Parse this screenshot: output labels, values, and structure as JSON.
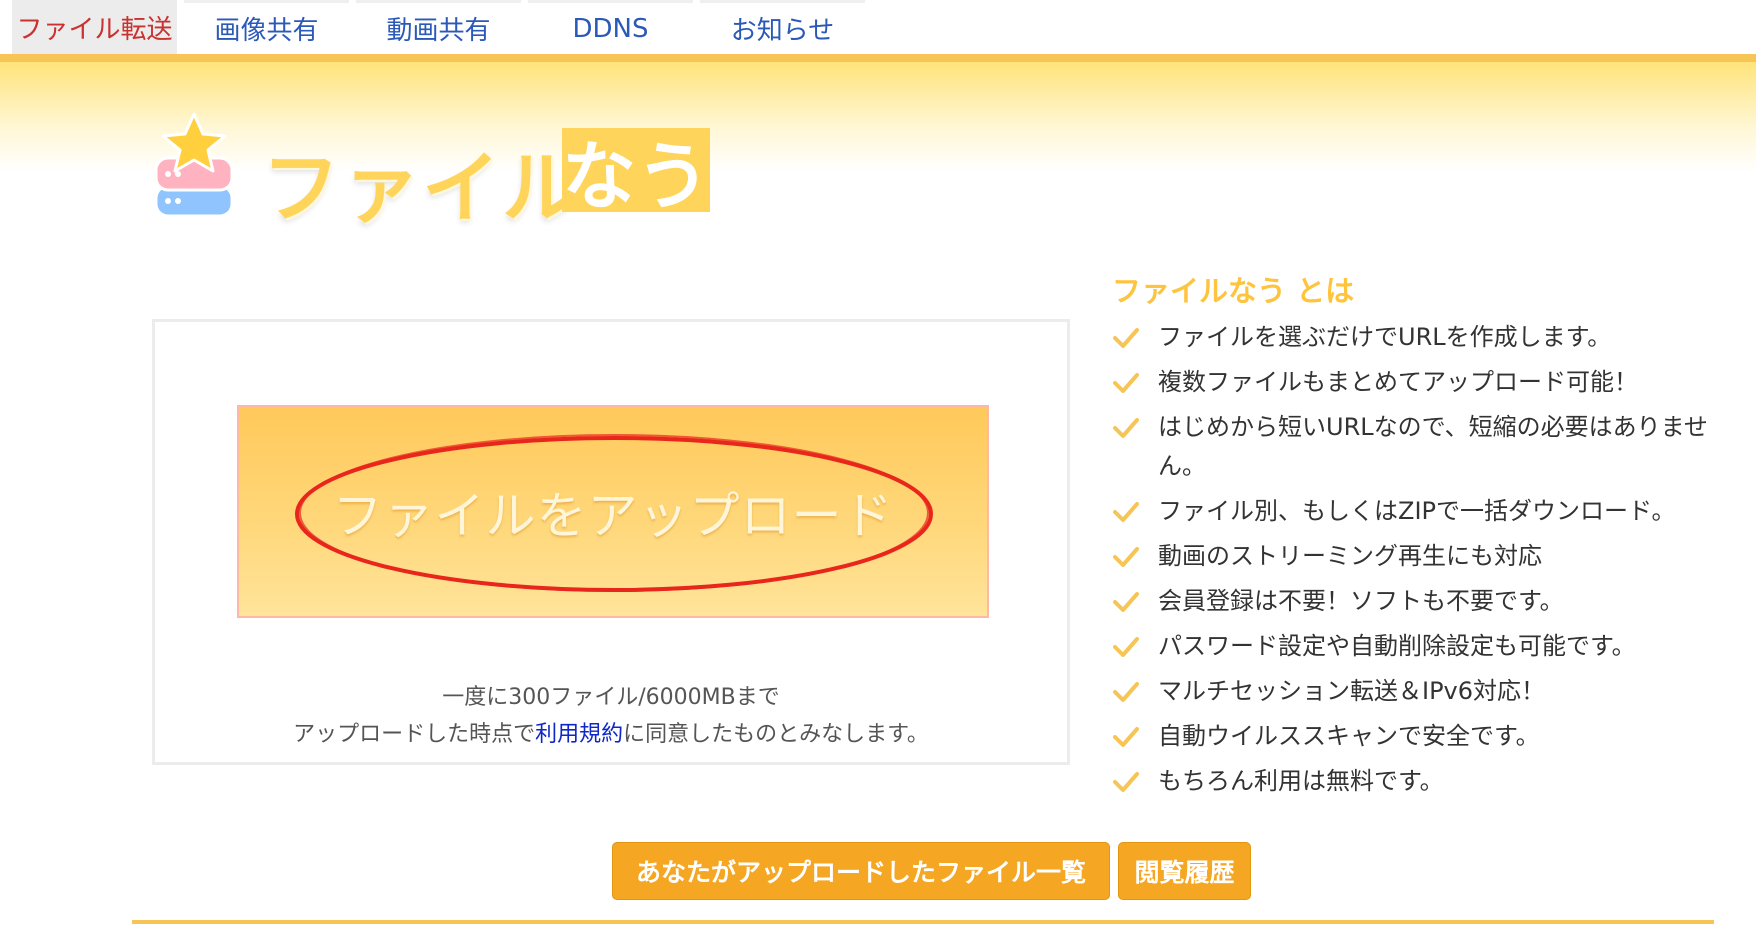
{
  "nav": {
    "tabs": [
      {
        "label": "ファイル転送",
        "active": true
      },
      {
        "label": "画像共有",
        "active": false
      },
      {
        "label": "動画共有",
        "active": false
      },
      {
        "label": "DDNS",
        "active": false
      },
      {
        "label": "お知らせ",
        "active": false
      }
    ]
  },
  "logo": {
    "word": "ファイル",
    "tag": "なう"
  },
  "upload": {
    "button_label": "ファイルをアップロード",
    "limit_note": "一度に300ファイル/6000MBまで",
    "terms_prefix": "アップロードした時点で",
    "terms_link": "利用規約",
    "terms_suffix": "に同意したものとみなします。"
  },
  "about": {
    "title": "ファイルなう とは",
    "features": [
      "ファイルを選ぶだけでURLを作成します。",
      "複数ファイルもまとめてアップロード可能！",
      "はじめから短いURLなので、短縮の必要はありません。",
      "ファイル別、もしくはZIPで一括ダウンロード。",
      "動画のストリーミング再生にも対応",
      "会員登録は不要！ソフトも不要です。",
      "パスワード設定や自動削除設定も可能です。",
      "マルチセッション転送＆IPv6対応！",
      "自動ウイルススキャンで安全です。",
      "もちろん利用は無料です。"
    ]
  },
  "buttons": {
    "my_files": "あなたがアップロードしたファイル一覧",
    "history": "閲覧履歴"
  },
  "colors": {
    "accent": "#f5a623",
    "logo": "#ffd45a",
    "check": "#f7c555",
    "link": "#2b59b8",
    "active_tab": "#c9322f",
    "annotation": "#e8261c"
  }
}
